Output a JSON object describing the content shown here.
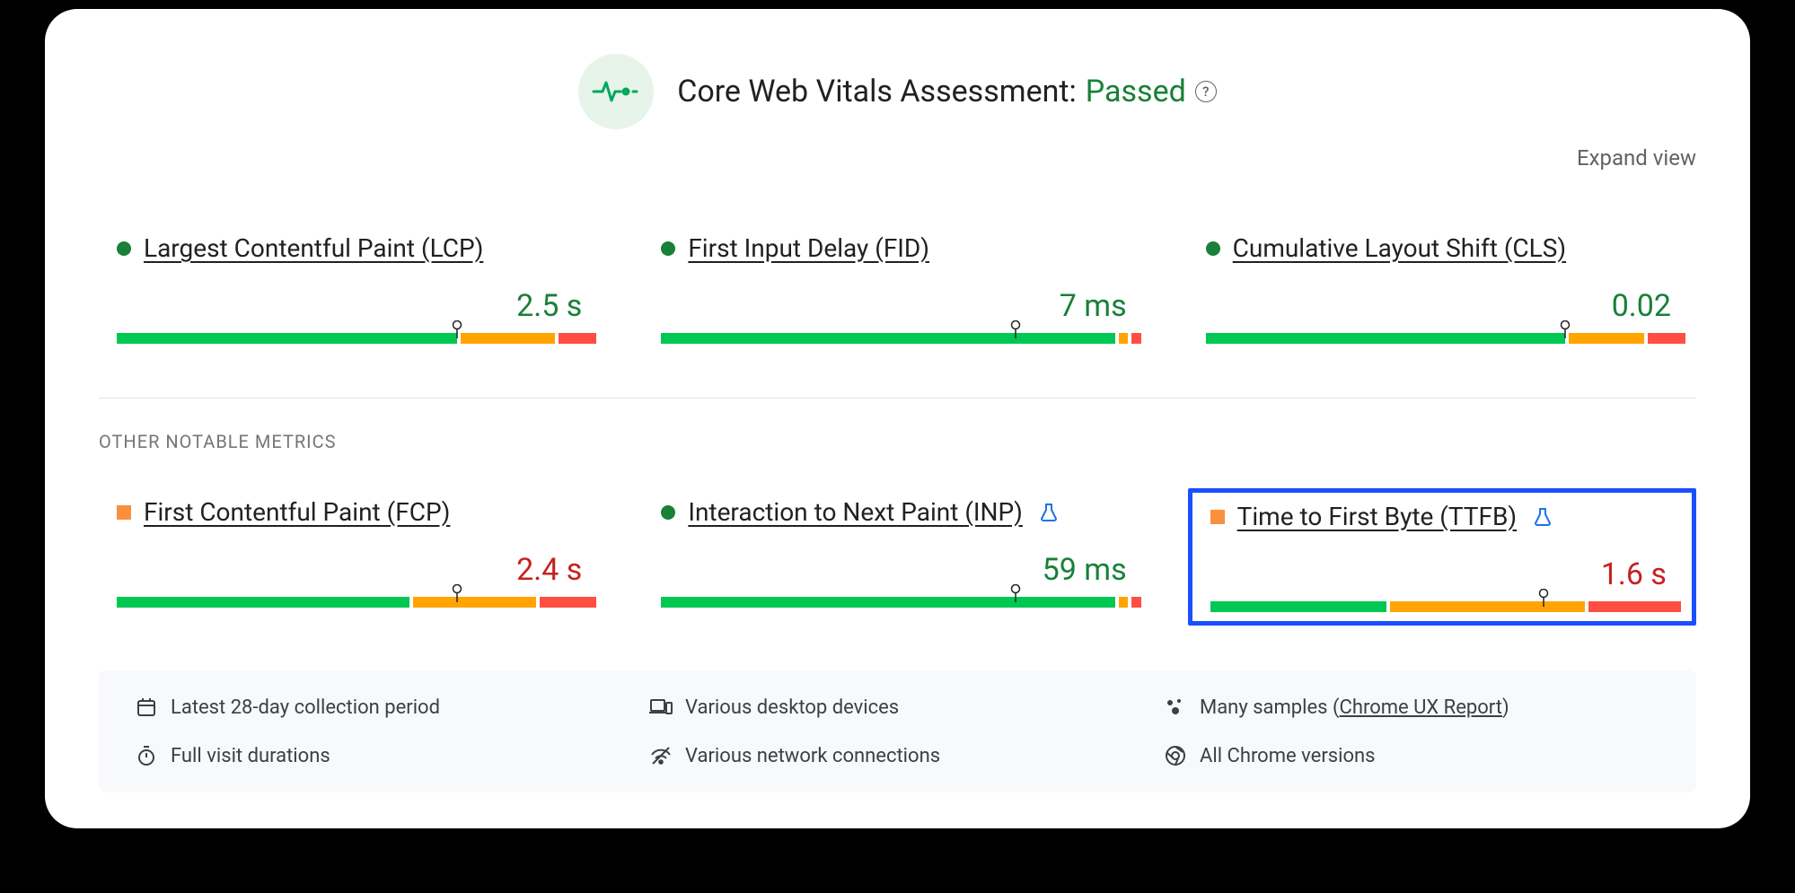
{
  "header": {
    "title": "Core Web Vitals Assessment:",
    "status": "Passed"
  },
  "expand_label": "Expand view",
  "section_other_label": "OTHER NOTABLE METRICS",
  "metrics": {
    "lcp": {
      "name": "Largest Contentful Paint (LCP)",
      "value": "2.5 s",
      "status": "green",
      "bar": {
        "green": 72,
        "orange": 20,
        "red": 8
      },
      "pin": 72
    },
    "fid": {
      "name": "First Input Delay (FID)",
      "value": "7 ms",
      "status": "green",
      "bar": {
        "green": 96,
        "orange": 2,
        "red": 2
      },
      "pin": 75
    },
    "cls": {
      "name": "Cumulative Layout Shift (CLS)",
      "value": "0.02",
      "status": "green",
      "bar": {
        "green": 76,
        "orange": 16,
        "red": 8
      },
      "pin": 76
    },
    "fcp": {
      "name": "First Contentful Paint (FCP)",
      "value": "2.4 s",
      "status": "orange",
      "bar": {
        "green": 62,
        "orange": 26,
        "red": 12
      },
      "pin": 72
    },
    "inp": {
      "name": "Interaction to Next Paint (INP)",
      "value": "59 ms",
      "status": "green",
      "bar": {
        "green": 96,
        "orange": 2,
        "red": 2
      },
      "pin": 75,
      "experimental": true
    },
    "ttfb": {
      "name": "Time to First Byte (TTFB)",
      "value": "1.6 s",
      "status": "orange",
      "bar": {
        "green": 38,
        "orange": 42,
        "red": 20
      },
      "pin": 72,
      "experimental": true
    }
  },
  "info": {
    "period": "Latest 28-day collection period",
    "devices": "Various desktop devices",
    "samples_prefix": "Many samples (",
    "samples_link": "Chrome UX Report",
    "samples_suffix": ")",
    "durations": "Full visit durations",
    "network": "Various network connections",
    "versions": "All Chrome versions"
  }
}
